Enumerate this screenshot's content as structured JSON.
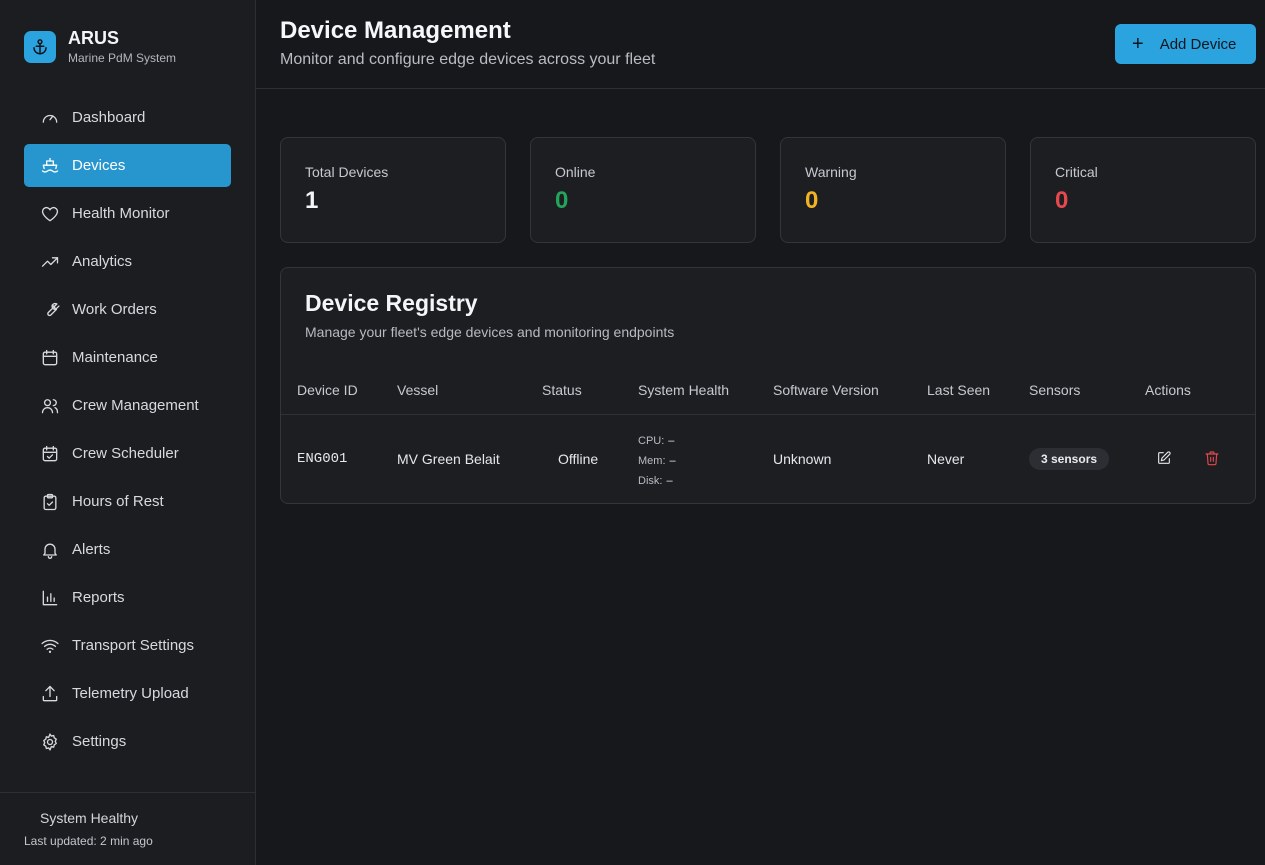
{
  "brand": {
    "title": "ARUS",
    "subtitle": "Marine PdM System",
    "accent": "#2ba3de"
  },
  "sidebar": {
    "items": [
      {
        "label": "Dashboard",
        "icon": "gauge-icon",
        "active": false
      },
      {
        "label": "Devices",
        "icon": "ship-icon",
        "active": true
      },
      {
        "label": "Health Monitor",
        "icon": "heart-icon",
        "active": false
      },
      {
        "label": "Analytics",
        "icon": "trending-up-icon",
        "active": false
      },
      {
        "label": "Work Orders",
        "icon": "wrench-icon",
        "active": false
      },
      {
        "label": "Maintenance",
        "icon": "calendar-icon",
        "active": false
      },
      {
        "label": "Crew Management",
        "icon": "users-icon",
        "active": false
      },
      {
        "label": "Crew Scheduler",
        "icon": "calendar-check-icon",
        "active": false
      },
      {
        "label": "Hours of Rest",
        "icon": "clipboard-check-icon",
        "active": false
      },
      {
        "label": "Alerts",
        "icon": "bell-icon",
        "active": false
      },
      {
        "label": "Reports",
        "icon": "bar-chart-icon",
        "active": false
      },
      {
        "label": "Transport Settings",
        "icon": "wifi-icon",
        "active": false
      },
      {
        "label": "Telemetry Upload",
        "icon": "upload-icon",
        "active": false
      },
      {
        "label": "Settings",
        "icon": "gear-icon",
        "active": false
      }
    ],
    "footer": {
      "status": "System Healthy",
      "updated": "Last updated: 2 min ago"
    }
  },
  "header": {
    "title": "Device Management",
    "subtitle": "Monitor and configure edge devices across your fleet",
    "add_button": "Add Device"
  },
  "stats": [
    {
      "label": "Total Devices",
      "value": "1",
      "color": "#f4f5f7"
    },
    {
      "label": "Online",
      "value": "0",
      "color": "#22a55a"
    },
    {
      "label": "Warning",
      "value": "0",
      "color": "#f0b323"
    },
    {
      "label": "Critical",
      "value": "0",
      "color": "#e5484d"
    }
  ],
  "registry": {
    "title": "Device Registry",
    "subtitle": "Manage your fleet's edge devices and monitoring endpoints",
    "columns": [
      "Device ID",
      "Vessel",
      "Status",
      "System Health",
      "Software Version",
      "Last Seen",
      "Sensors",
      "Actions"
    ],
    "rows": [
      {
        "device_id": "ENG001",
        "vessel": "MV Green Belait",
        "status": "Offline",
        "health": {
          "cpu_label": "CPU:",
          "cpu": "–",
          "mem_label": "Mem:",
          "mem": "–",
          "disk_label": "Disk:",
          "disk": "–"
        },
        "software": "Unknown",
        "last_seen": "Never",
        "sensors": "3 sensors"
      }
    ]
  },
  "colors": {
    "delete": "#e5484d",
    "active_nav": "#2796cf"
  }
}
